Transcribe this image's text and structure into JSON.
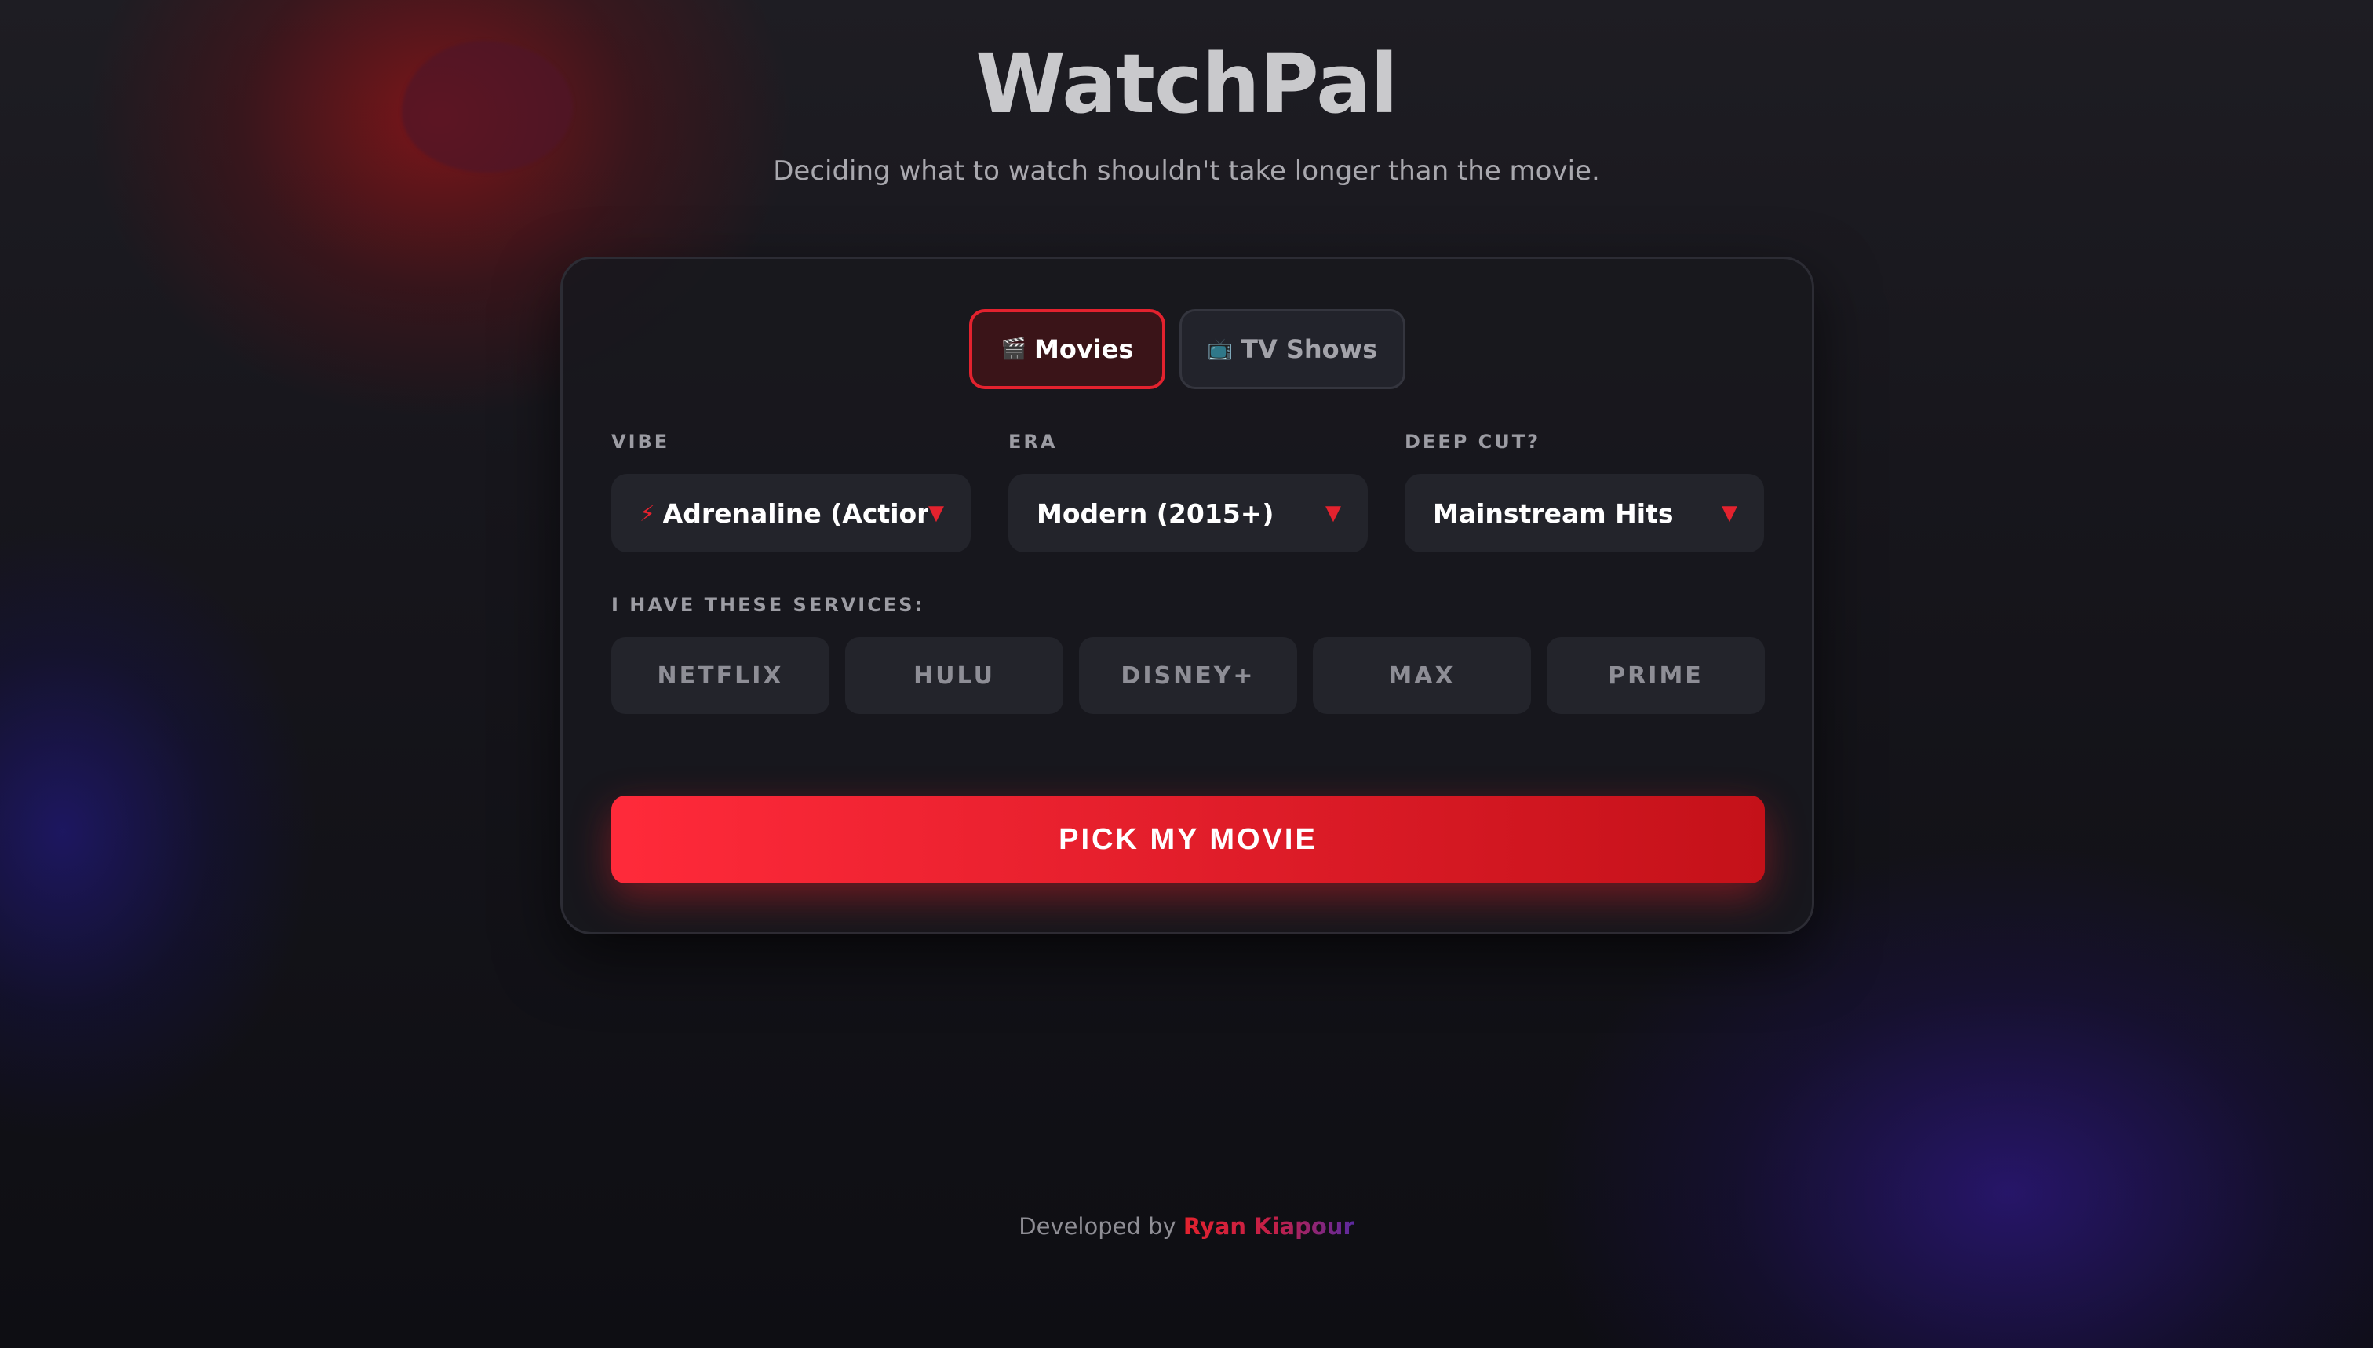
{
  "app": {
    "title": "WatchPal",
    "subtitle": "Deciding what to watch shouldn't take longer than the movie."
  },
  "tabs": [
    {
      "icon": "🎬",
      "icon_name": "clapperboard-icon",
      "label": "Movies",
      "active": true
    },
    {
      "icon": "📺",
      "icon_name": "television-icon",
      "label": "TV Shows",
      "active": false
    }
  ],
  "filters": {
    "vibe": {
      "label": "VIBE",
      "icon": "⚡",
      "value": "Adrenaline (Action",
      "caret": "▼"
    },
    "era": {
      "label": "ERA",
      "value": "Modern (2015+)",
      "caret": "▼"
    },
    "deep_cut": {
      "label": "DEEP CUT?",
      "value": "Mainstream Hits",
      "caret": "▼"
    }
  },
  "services": {
    "label": "I HAVE THESE SERVICES:",
    "items": [
      "NETFLIX",
      "HULU",
      "DISNEY+",
      "MAX",
      "PRIME"
    ]
  },
  "action": {
    "label": "PICK MY MOVIE"
  },
  "footer": {
    "prefix": "Developed by",
    "author": "Ryan Kiapour"
  },
  "colors": {
    "accent": "#e3222e",
    "background": "#0f0f13",
    "card": "#18181e"
  }
}
